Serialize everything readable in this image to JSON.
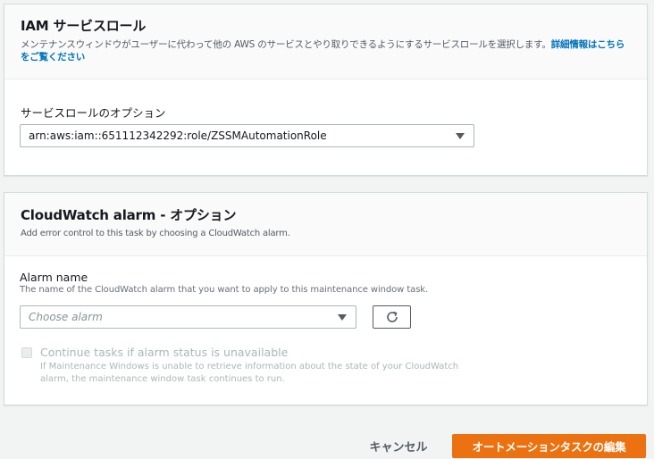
{
  "iam": {
    "title": "IAM サービスロール",
    "desc": "メンテナンスウィンドウがユーザーに代わって他の AWS のサービスとやり取りできるようにするサービスロールを選択します。",
    "info_link": "詳細情報はこちらをご覧ください",
    "field_label": "サービスロールのオプション",
    "selected_role": "arn:aws:iam::651112342292:role/ZSSMAutomationRole"
  },
  "cloudwatch": {
    "title": "CloudWatch alarm - オプション",
    "desc": "Add error control to this task by choosing a CloudWatch alarm.",
    "alarm_label": "Alarm name",
    "alarm_desc": "The name of the CloudWatch alarm that you want to apply to this maintenance window task.",
    "alarm_placeholder": "Choose alarm",
    "continue_label": "Continue tasks if alarm status is unavailable",
    "continue_desc_line1": "If Maintenance Windows is unable to retrieve information about the state of your CloudWatch",
    "continue_desc_line2": "alarm, the maintenance window task continues to run."
  },
  "footer": {
    "cancel_label": "キャンセル",
    "submit_label": "オートメーションタスクの編集"
  },
  "colors": {
    "primary": "#ec7211",
    "link": "#0073bb",
    "background": "#f2f3f3"
  },
  "icons": {
    "dropdown": "caret-down-icon",
    "refresh": "refresh-icon"
  }
}
